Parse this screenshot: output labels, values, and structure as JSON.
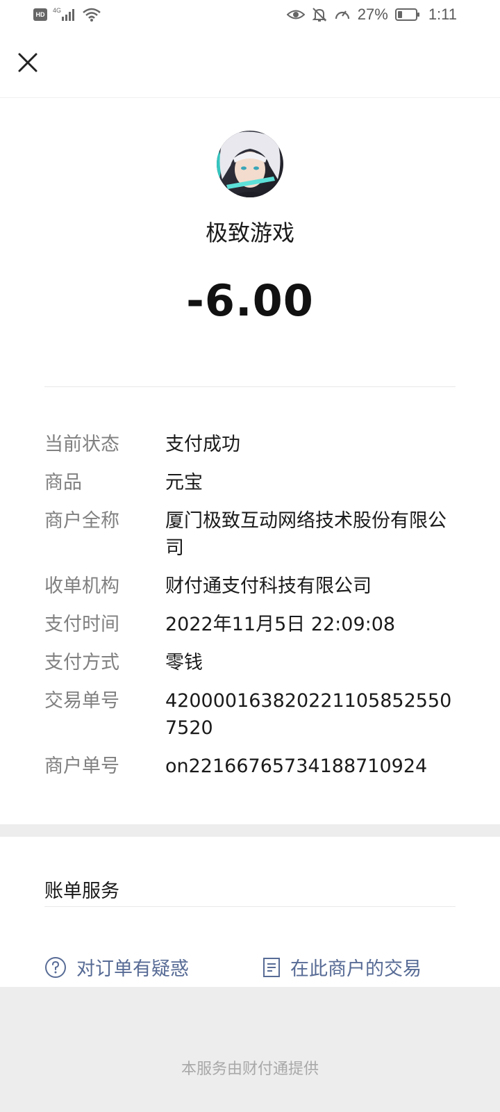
{
  "status_bar": {
    "network": "4G",
    "battery": "27%",
    "battery_level": 0.27,
    "time": "1:11"
  },
  "merchant": {
    "name": "极致游戏"
  },
  "amount": "-6.00",
  "details": [
    {
      "label": "当前状态",
      "value": "支付成功"
    },
    {
      "label": "商品",
      "value": "元宝"
    },
    {
      "label": "商户全称",
      "value": "厦门极致互动网络技术股份有限公司"
    },
    {
      "label": "收单机构",
      "value": "财付通支付科技有限公司"
    },
    {
      "label": "支付时间",
      "value": "2022年11月5日 22:09:08"
    },
    {
      "label": "支付方式",
      "value": "零钱"
    },
    {
      "label": "交易单号",
      "value": "4200001638202211058525507520"
    },
    {
      "label": "商户单号",
      "value": "on22166765734188710924"
    }
  ],
  "services": {
    "title": "账单服务",
    "question_link": "对订单有疑惑",
    "merchant_link": "在此商户的交易"
  },
  "footer": "本服务由财付通提供",
  "colors": {
    "link": "#576b95",
    "label": "#808080",
    "band": "#ededed"
  }
}
